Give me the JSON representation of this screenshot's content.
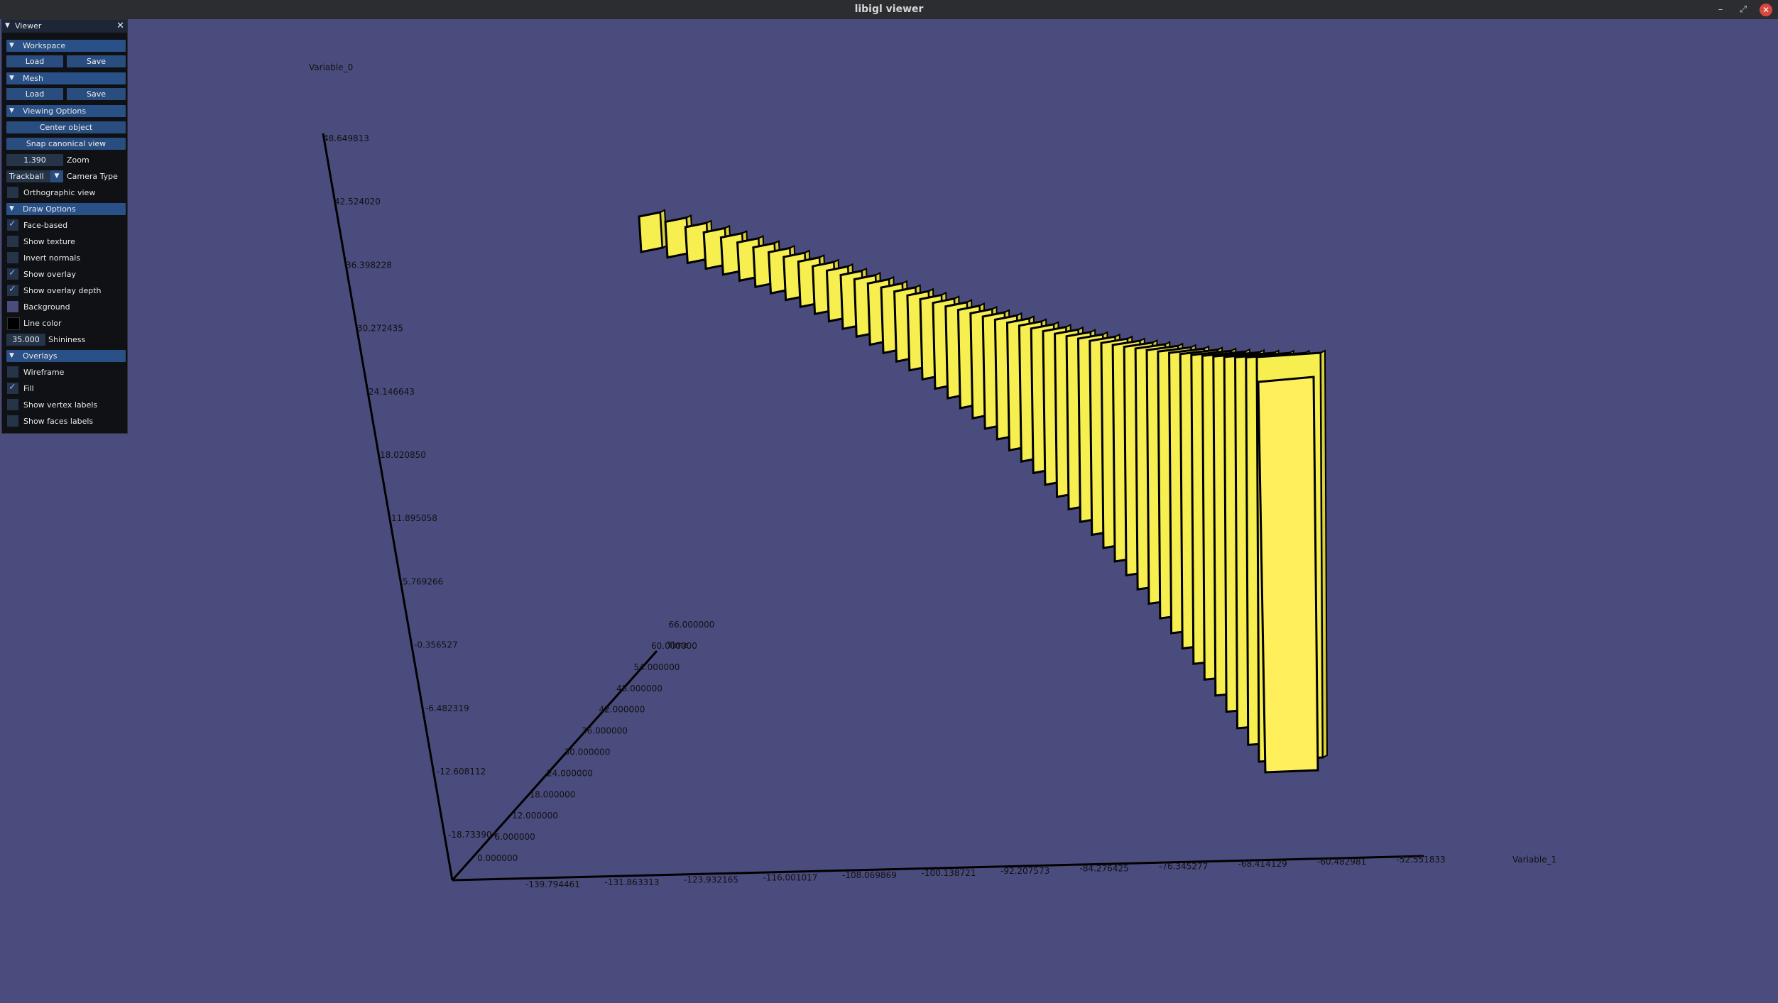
{
  "window": {
    "title": "libigl viewer",
    "minimize": "–",
    "maximize": "⤢",
    "close": "✕"
  },
  "panel": {
    "title": "Viewer",
    "workspace": {
      "header": "Workspace",
      "load": "Load",
      "save": "Save"
    },
    "mesh": {
      "header": "Mesh",
      "load": "Load",
      "save": "Save"
    },
    "viewing": {
      "header": "Viewing Options",
      "center_object": "Center object",
      "snap_view": "Snap canonical view",
      "zoom_value": "1.390",
      "zoom_label": "Zoom",
      "camera_value": "Trackball",
      "camera_label": "Camera Type",
      "ortho_label": "Orthographic view",
      "ortho_checked": false
    },
    "draw": {
      "header": "Draw Options",
      "face_based": "Face-based",
      "face_based_checked": true,
      "show_texture": "Show texture",
      "show_texture_checked": false,
      "invert_normals": "Invert normals",
      "invert_normals_checked": false,
      "show_overlay": "Show overlay",
      "show_overlay_checked": true,
      "show_overlay_depth": "Show overlay depth",
      "show_overlay_depth_checked": true,
      "background": "Background",
      "background_color": "#4b4c7e",
      "line_color": "Line color",
      "line_color_value": "#000000",
      "shininess_value": "35.000",
      "shininess_label": "Shininess"
    },
    "overlays": {
      "header": "Overlays",
      "wireframe": "Wireframe",
      "wireframe_checked": false,
      "fill": "Fill",
      "fill_checked": true,
      "vertex_labels": "Show vertex labels",
      "vertex_labels_checked": false,
      "faces_labels": "Show faces labels",
      "faces_labels_checked": false
    }
  },
  "scene": {
    "background": "#4b4c7e",
    "mesh_color": "#f7ef4f",
    "y_axis": {
      "name": "Variable_0",
      "ticks": [
        "48.649813",
        "42.524020",
        "36.398228",
        "30.272435",
        "24.146643",
        "18.020850",
        "11.895058",
        "5.769266",
        "-0.356527",
        "-6.482319",
        "-12.608112",
        "-18.733904"
      ]
    },
    "x_axis": {
      "name": "Variable_1",
      "ticks": [
        "-139.794461",
        "-131.863313",
        "-123.932165",
        "-116.001017",
        "-108.069869",
        "-100.138721",
        "-92.207573",
        "-84.276425",
        "-76.345277",
        "-68.414129",
        "-60.482981",
        "-52.551833"
      ]
    },
    "z_axis": {
      "name": "Time",
      "ticks": [
        "0.000000",
        "6.000000",
        "12.000000",
        "18.000000",
        "24.000000",
        "30.000000",
        "36.000000",
        "42.000000",
        "48.000000",
        "54.000000",
        "60.000000",
        "66.000000"
      ]
    }
  }
}
